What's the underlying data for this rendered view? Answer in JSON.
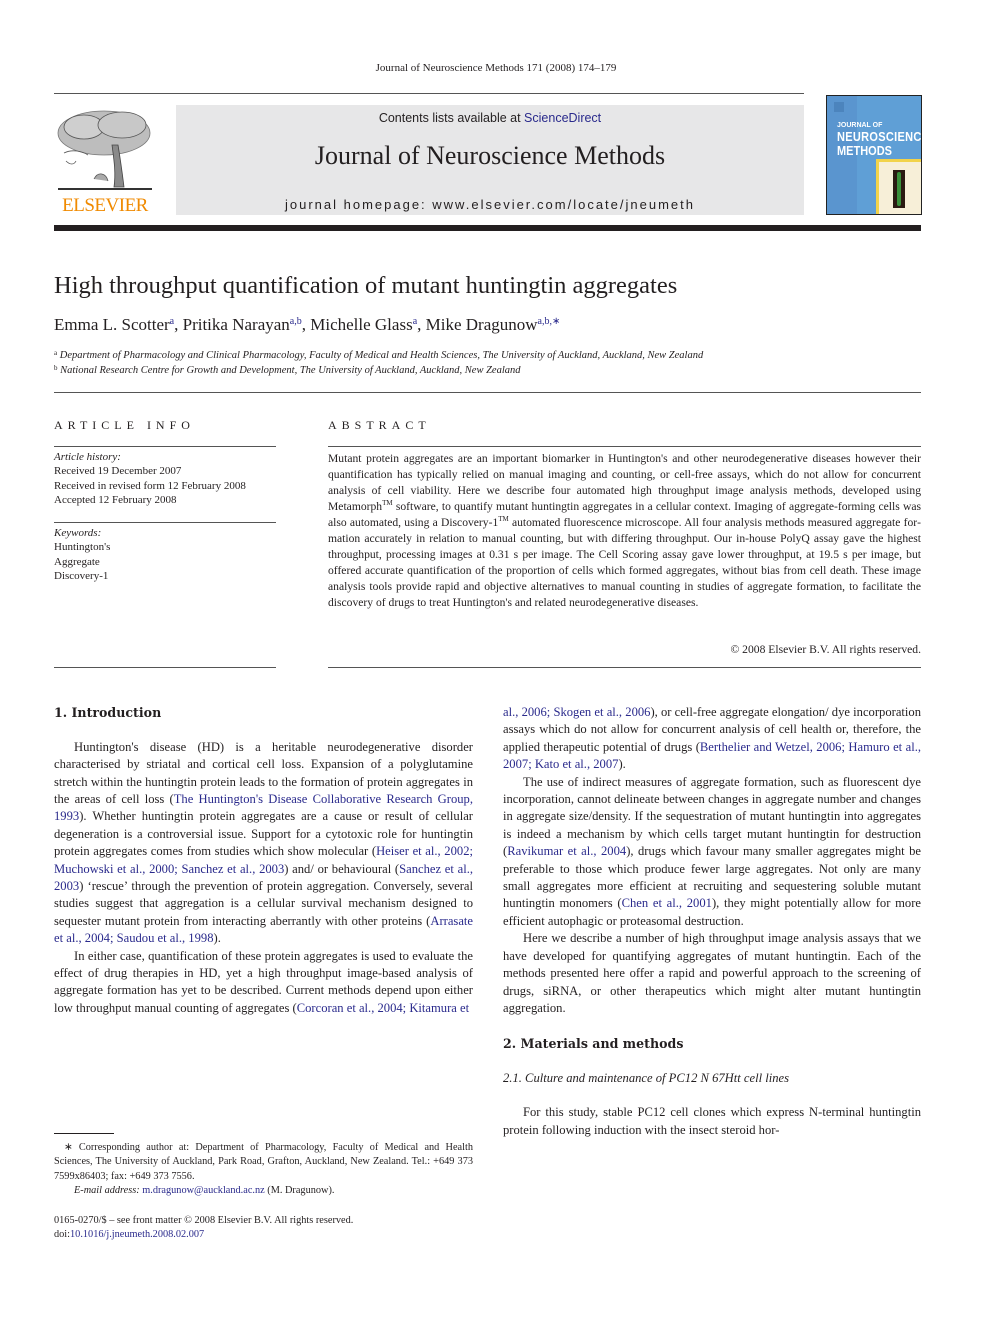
{
  "running_head": "Journal of Neuroscience Methods 171 (2008) 174–179",
  "masthead": {
    "publisher_logo_text": "ELSEVIER",
    "contents_prefix": "Contents lists available at ",
    "contents_link": "ScienceDirect",
    "journal_name": "Journal of Neuroscience Methods",
    "homepage": "journal homepage: www.elsevier.com/locate/jneumeth",
    "cover": {
      "line1": "JOURNAL OF",
      "line2": "NEUROSCIENCE",
      "line3": "METHODS"
    }
  },
  "article": {
    "title": "High throughput quantification of mutant huntingtin aggregates",
    "authors": [
      {
        "name": "Emma L. Scotter",
        "affil": "a"
      },
      {
        "name": "Pritika Narayan",
        "affil": "a,b"
      },
      {
        "name": "Michelle Glass",
        "affil": "a"
      },
      {
        "name": "Mike Dragunow",
        "affil": "a,b,∗"
      }
    ],
    "affiliations": [
      {
        "mark": "a",
        "text": "Department of Pharmacology and Clinical Pharmacology, Faculty of Medical and Health Sciences, The University of Auckland, Auckland, New Zealand"
      },
      {
        "mark": "b",
        "text": "National Research Centre for Growth and Development, The University of Auckland, Auckland, New Zealand"
      }
    ]
  },
  "article_info": {
    "heading": "ARTICLE INFO",
    "history_label": "Article history:",
    "history": [
      "Received 19 December 2007",
      "Received in revised form 12 February 2008",
      "Accepted 12 February 2008"
    ],
    "keywords_label": "Keywords:",
    "keywords": [
      "Huntington's",
      "Aggregate",
      "Discovery-1"
    ]
  },
  "abstract": {
    "heading": "ABSTRACT",
    "part1": "Mutant protein aggregates are an important biomarker in Huntington's and other neurodegenerative diseases however their quantification has typically relied on manual imaging and counting, or cell-free assays, which do not allow for concurrent analysis of cell viability. Here we describe four automated high throughput image analysis methods, developed using Metamorph",
    "tm1": "TM",
    "part2": " software, to quantify mutant hunt­ingtin aggregates in a cellular context. Imaging of aggregate-forming cells was also automated, using a Discovery-1",
    "tm2": "TM",
    "part3": " automated fluorescence microscope. All four analysis methods measured aggregate for­mation accurately in relation to manual counting, but with differing throughput. Our in-house PolyQ assay gave the highest throughput, processing images at 0.31 s per image. The Cell Scoring assay gave lower throughput, at 19.5 s per image, but offered accurate quantification of the proportion of cells which formed aggregates, without bias from cell death. These image analysis tools provide rapid and objective alternatives to manual counting in studies of aggregate formation, to facilitate the discovery of drugs to treat Huntington's and related neurodegenerative diseases.",
    "copyright": "© 2008 Elsevier B.V. All rights reserved."
  },
  "body": {
    "sec1_heading": "1.  Introduction",
    "p1": [
      {
        "t": "Huntington's disease (HD) is a heritable neurodegenerative dis­order characterised by striatal and cortical cell loss. Expansion of a polyglutamine stretch within the huntingtin protein leads to the formation of protein aggregates in the areas of cell loss ("
      },
      {
        "ref": "The Huntington's Disease Collaborative Research Group, 1993"
      },
      {
        "t": "). Whether huntingtin protein aggregates are a cause or result of cellular degeneration is a controversial issue. Support for a cyto­toxic role for huntingtin protein aggregates comes from studies which show molecular ("
      },
      {
        "ref": "Heiser et al., 2002; Muchowski et al., 2000; Sanchez et al., 2003"
      },
      {
        "t": ") and/ or behavioural ("
      },
      {
        "ref": "Sanchez et al., 2003"
      },
      {
        "t": ") ‘rescue’ through the prevention of protein aggregation. Conversely, several studies suggest that aggregation is a cellular survival mech­anism designed to sequester mutant protein from interacting aberrantly with other proteins ("
      },
      {
        "ref": "Arrasate et al., 2004; Saudou et al., 1998"
      },
      {
        "t": ")."
      }
    ],
    "p2": [
      {
        "t": "In either case, quantification of these protein aggregates is used to evaluate the effect of drug therapies in HD, yet a high through­put image-based analysis of aggregate formation has yet to be described. Current methods depend upon either low throughput manual counting of aggregates ("
      },
      {
        "ref": "Corcoran et al., 2004; Kitamura et al., 2006; Skogen et al., 2006"
      },
      {
        "t": "), or cell-free aggregate elongation/ dye incorporation assays which do not allow for concurrent analy­sis of cell health or, therefore, the applied therapeutic potential of drugs ("
      },
      {
        "ref": "Berthelier and Wetzel, 2006; Hamuro et al., 2007; Kato et al., 2007"
      },
      {
        "t": ")."
      }
    ],
    "p3": [
      {
        "t": "The use of indirect measures of aggregate formation, such as fluorescent dye incorporation, cannot delineate between changes in aggregate number and changes in aggregate size/density. If the sequestration of mutant huntingtin into aggregates is indeed a mechanism by which cells target mutant huntingtin for destruc­tion ("
      },
      {
        "ref": "Ravikumar et al., 2004"
      },
      {
        "t": "), drugs which favour many smaller aggregates might be preferable to those which produce fewer large aggregates. Not only are many small aggregates more efficient at recruiting and sequestering soluble mutant huntingtin monomers ("
      },
      {
        "ref": "Chen et al., 2001"
      },
      {
        "t": "), they might potentially allow for more efficient autophagic or proteasomal destruction."
      }
    ],
    "p4": [
      {
        "t": "Here we describe a number of high throughput image analysis assays that we have developed for quantifying aggregates of mutant huntingtin. Each of the methods presented here offer a rapid and powerful approach to the screening of drugs, siRNA, or other ther­apeutics which might alter mutant huntingtin aggregation."
      }
    ],
    "sec2_heading": "2.  Materials and methods",
    "sec21_heading": "2.1.  Culture and maintenance of PC12 N 67Htt cell lines",
    "p5": [
      {
        "t": "For this study, stable PC12 cell clones which express N-terminal huntingtin protein following induction with the insect steroid hor-"
      }
    ]
  },
  "footnote": {
    "corresponding": "∗ Corresponding author at: Department of Pharmacology, Faculty of Medical and Health Sciences, The University of Auckland, Park Road, Grafton, Auckland, New Zealand. Tel.: +649 373 7599x86403; fax: +649 373 7556.",
    "email_label": "E-mail address: ",
    "email": "m.dragunow@auckland.ac.nz",
    "email_suffix": " (M. Dragunow)."
  },
  "issn_line": "0165-0270/$ – see front matter © 2008 Elsevier B.V. All rights reserved.",
  "doi_prefix": "doi:",
  "doi": "10.1016/j.jneumeth.2008.02.007",
  "colors": {
    "link": "#2a2a8c",
    "elsevier_orange": "#f08a00",
    "masthead_bg": "#e7e7e8"
  }
}
